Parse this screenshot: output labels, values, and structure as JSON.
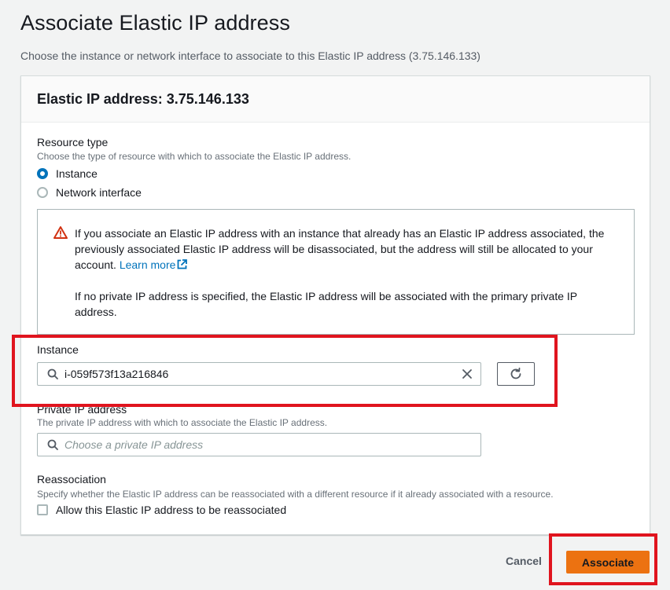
{
  "page": {
    "title": "Associate Elastic IP address",
    "description": "Choose the instance or network interface to associate to this Elastic IP address (3.75.146.133)"
  },
  "panel": {
    "heading": "Elastic IP address: 3.75.146.133"
  },
  "resource_type": {
    "label": "Resource type",
    "description": "Choose the type of resource with which to associate the Elastic IP address.",
    "options": [
      {
        "label": "Instance",
        "selected": true
      },
      {
        "label": "Network interface",
        "selected": false
      }
    ]
  },
  "alert": {
    "icon": "warning-icon",
    "text_1": "If you associate an Elastic IP address with an instance that already has an Elastic IP address associated, the previously associated Elastic IP address will be disassociated, but the address will still be allocated to your account.",
    "link": "Learn more",
    "text_2": "If no private IP address is specified, the Elastic IP address will be associated with the primary private IP address."
  },
  "instance": {
    "label": "Instance",
    "value": "i-059f573f13a216846"
  },
  "private_ip": {
    "label": "Private IP address",
    "description": "The private IP address with which to associate the Elastic IP address.",
    "placeholder": "Choose a private IP address"
  },
  "reassociation": {
    "label": "Reassociation",
    "description": "Specify whether the Elastic IP address can be reassociated with a different resource if it already associated with a resource.",
    "checkbox_label": "Allow this Elastic IP address to be reassociated",
    "checked": false
  },
  "footer": {
    "cancel_label": "Cancel",
    "associate_label": "Associate"
  },
  "colors": {
    "primary_button": "#ec7211",
    "link": "#0073bb",
    "highlight": "#e0141e",
    "warning": "#d13212"
  }
}
